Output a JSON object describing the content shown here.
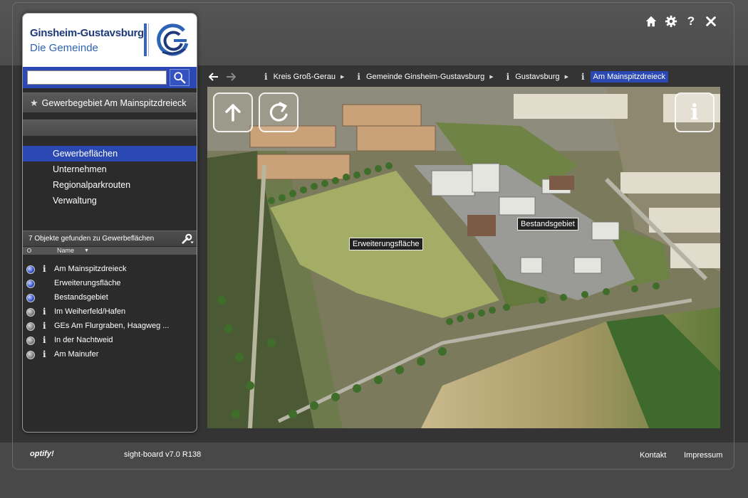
{
  "header": {
    "icons": [
      "home-icon",
      "gear-icon",
      "help-icon",
      "close-icon"
    ],
    "help_glyph": "?"
  },
  "sidebar": {
    "logo_line1": "Ginsheim-Gustavsburg",
    "logo_line2": "Die Gemeinde",
    "search": {
      "value": "",
      "placeholder": ""
    },
    "favorite_label": "Gewerbegebiet Am Mainspitzdreieck",
    "menu": [
      {
        "label": "Gewerbeflächen",
        "active": true
      },
      {
        "label": "Unternehmen",
        "active": false
      },
      {
        "label": "Regionalparkrouten",
        "active": false
      },
      {
        "label": "Verwaltung",
        "active": false
      }
    ],
    "results_header": "7 Objekte gefunden zu Gewerbeflächen",
    "column_name": "Name",
    "results": [
      {
        "label": "Am Mainspitzdreieck",
        "ball": "blue",
        "info": true
      },
      {
        "label": "Erweiterungsfläche",
        "ball": "blue",
        "info": false
      },
      {
        "label": "Bestandsgebiet",
        "ball": "blue",
        "info": false
      },
      {
        "label": "Im Weiherfeld/Hafen",
        "ball": "grey",
        "info": true
      },
      {
        "label": "GEs Am Flurgraben, Haagweg ...",
        "ball": "grey",
        "info": true
      },
      {
        "label": "In der Nachtweid",
        "ball": "grey",
        "info": true
      },
      {
        "label": "Am Mainufer",
        "ball": "grey",
        "info": true
      }
    ],
    "info_glyph": "i"
  },
  "breadcrumb": {
    "items": [
      {
        "label": "Kreis Groß-Gerau",
        "current": false
      },
      {
        "label": "Gemeinde Ginsheim-Gustavsburg",
        "current": false
      },
      {
        "label": "Gustavsburg",
        "current": false
      },
      {
        "label": "Am Mainspitzdreieck",
        "current": true
      }
    ]
  },
  "map": {
    "labels": {
      "erweiterung": "Erweiterungsfläche",
      "bestand": "Bestandsgebiet"
    },
    "info_glyph": "i"
  },
  "footer": {
    "brand": "optify!",
    "version": "sight-board v7.0 R138",
    "contact": "Kontakt",
    "imprint": "Impressum"
  },
  "colors": {
    "accent": "#2c49b3",
    "logo_dark": "#1e3a78",
    "logo_light": "#2d63b5"
  }
}
